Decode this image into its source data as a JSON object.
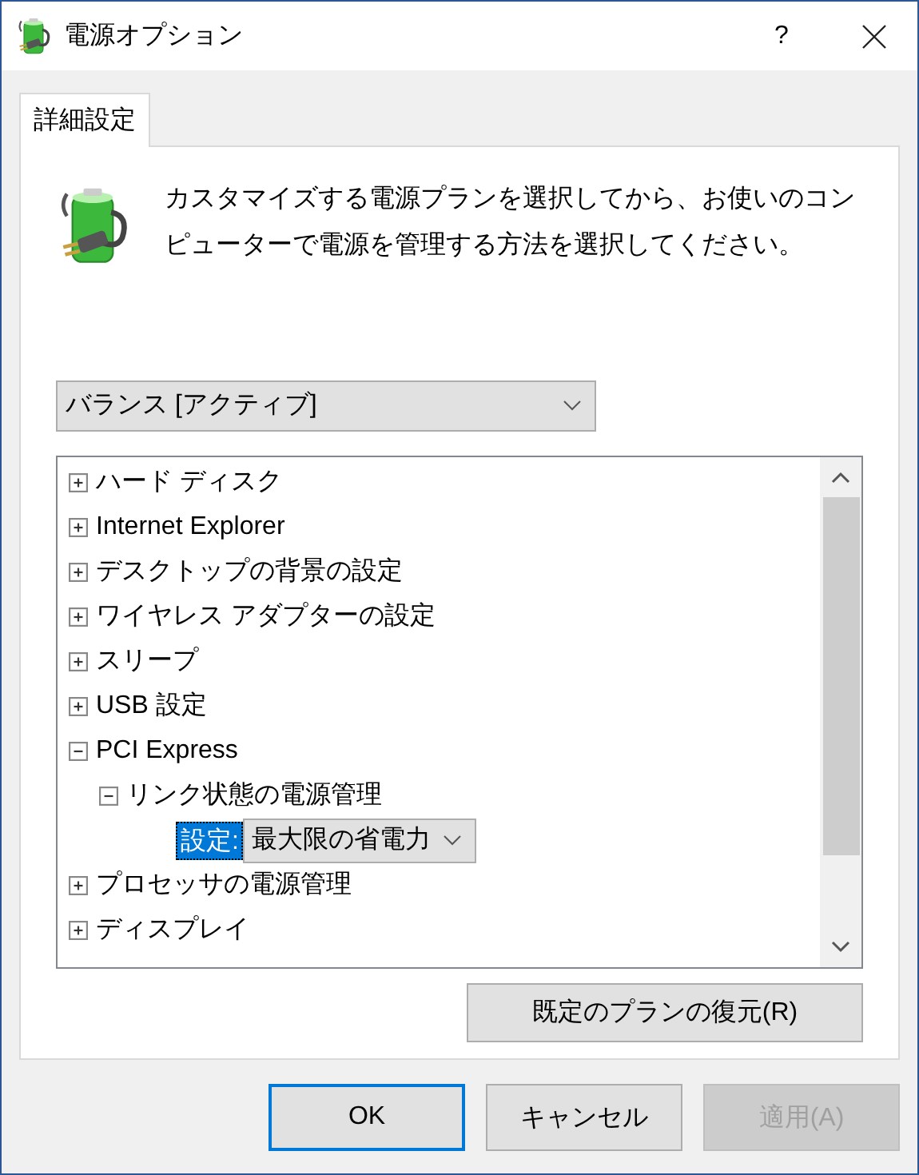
{
  "window": {
    "title": "電源オプション",
    "help": "?"
  },
  "tabs": [
    {
      "label": "詳細設定",
      "selected": true
    }
  ],
  "description": "カスタマイズする電源プランを選択してから、お使いのコンピューターで電源を管理する方法を選択してください。",
  "plan_select": {
    "value": "バランス [アクティブ]"
  },
  "tree": [
    {
      "kind": "group",
      "label": "ハード ディスク",
      "expanded": false
    },
    {
      "kind": "group",
      "label": "Internet Explorer",
      "expanded": false
    },
    {
      "kind": "group",
      "label": "デスクトップの背景の設定",
      "expanded": false
    },
    {
      "kind": "group",
      "label": "ワイヤレス アダプターの設定",
      "expanded": false
    },
    {
      "kind": "group",
      "label": "スリープ",
      "expanded": false
    },
    {
      "kind": "group",
      "label": "USB 設定",
      "expanded": false
    },
    {
      "kind": "group",
      "label": "PCI Express",
      "expanded": true,
      "children": [
        {
          "kind": "group",
          "label": "リンク状態の電源管理",
          "expanded": true,
          "children": [
            {
              "kind": "setting",
              "label": "設定:",
              "selected": true,
              "value": "最大限の省電力"
            }
          ]
        }
      ]
    },
    {
      "kind": "group",
      "label": "プロセッサの電源管理",
      "expanded": false
    },
    {
      "kind": "group",
      "label": "ディスプレイ",
      "expanded": false
    }
  ],
  "restore_button": "既定のプランの復元(R)",
  "buttons": [
    {
      "label": "OK",
      "default": true,
      "disabled": false
    },
    {
      "label": "キャンセル",
      "default": false,
      "disabled": false
    },
    {
      "label": "適用(A)",
      "default": false,
      "disabled": true
    }
  ]
}
